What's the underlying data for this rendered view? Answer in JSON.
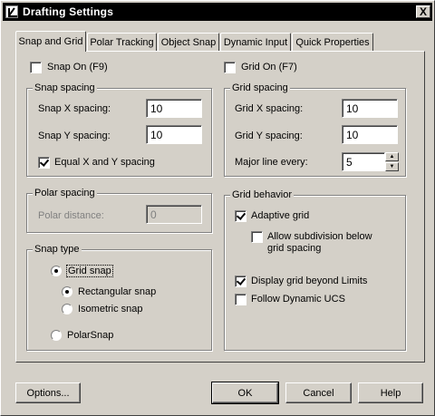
{
  "window": {
    "title": "Drafting Settings",
    "close_glyph": "X"
  },
  "tabs": [
    {
      "label": "Snap and Grid",
      "active": true
    },
    {
      "label": "Polar Tracking",
      "active": false
    },
    {
      "label": "Object Snap",
      "active": false
    },
    {
      "label": "Dynamic Input",
      "active": false
    },
    {
      "label": "Quick Properties",
      "active": false
    }
  ],
  "snap": {
    "snap_on_label": "Snap On (F9)",
    "snap_on_checked": false,
    "spacing_group": "Snap spacing",
    "x_label": "Snap X spacing:",
    "x_value": "10",
    "y_label": "Snap Y spacing:",
    "y_value": "10",
    "equal_label": "Equal X and Y spacing",
    "equal_checked": true,
    "polar_group": "Polar spacing",
    "polar_label": "Polar distance:",
    "polar_value": "0",
    "type_group": "Snap type",
    "grid_snap_label": "Grid snap",
    "rect_label": "Rectangular snap",
    "iso_label": "Isometric snap",
    "polarsnap_label": "PolarSnap"
  },
  "grid": {
    "grid_on_label": "Grid On (F7)",
    "grid_on_checked": false,
    "spacing_group": "Grid spacing",
    "x_label": "Grid X spacing:",
    "x_value": "10",
    "y_label": "Grid Y spacing:",
    "y_value": "10",
    "major_label": "Major line every:",
    "major_value": "5",
    "behavior_group": "Grid behavior",
    "adaptive_label": "Adaptive grid",
    "adaptive_checked": true,
    "subdivision_label_1": "Allow subdivision below",
    "subdivision_label_2": "grid spacing",
    "beyond_label": "Display grid beyond Limits",
    "beyond_checked": true,
    "follow_label": "Follow Dynamic UCS",
    "follow_checked": false
  },
  "buttons": {
    "options": "Options...",
    "ok": "OK",
    "cancel": "Cancel",
    "help": "Help"
  }
}
